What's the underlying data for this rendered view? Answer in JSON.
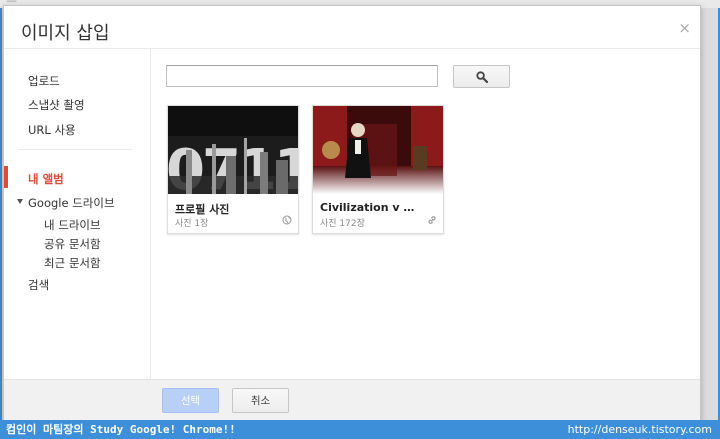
{
  "dialog": {
    "title": "이미지 삽입",
    "close_glyph": "×"
  },
  "sidebar": {
    "items": [
      {
        "label": "업로드"
      },
      {
        "label": "스냅샷 촬영"
      },
      {
        "label": "URL 사용"
      },
      {
        "label": "내 앨범"
      },
      {
        "label": "Google 드라이브"
      },
      {
        "label": "내 드라이브"
      },
      {
        "label": "공유 문서함"
      },
      {
        "label": "최근 문서함"
      },
      {
        "label": "검색"
      }
    ]
  },
  "search": {
    "value": "",
    "placeholder": ""
  },
  "albums": [
    {
      "name": "프로필 사진",
      "count": "사진 1장",
      "thumb_text": "0711",
      "badge_icon": "globe-icon"
    },
    {
      "name": "Civilization v Ame...",
      "count": "사진 172장",
      "badge_icon": "link-icon"
    }
  ],
  "footer": {
    "select_label": "선택",
    "cancel_label": "취소"
  },
  "watermark": {
    "left": "컴인이 마팀장의 Study Google! Chrome!!",
    "right": "http://denseuk.tistory.com"
  },
  "colors": {
    "accent_blue": "#3c8fd8",
    "active_red": "#dd4b39",
    "select_button": "#b8cff7"
  }
}
